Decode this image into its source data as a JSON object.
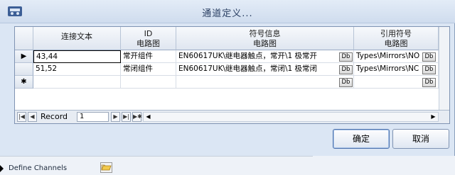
{
  "window": {
    "title": "通道定义..."
  },
  "grid": {
    "columns": [
      {
        "line1": "连接文本",
        "line2": ""
      },
      {
        "line1": "ID",
        "line2": "电路图"
      },
      {
        "line1": "符号信息",
        "line2": "电路图"
      },
      {
        "line1": "引用符号",
        "line2": "电路图"
      }
    ],
    "rows": [
      {
        "marker": "▶",
        "text": "43,44",
        "id": "常开组件",
        "symbol": "EN60617UK\\继电器触点，常开\\1 极常开",
        "ref": "Types\\Mirrors\\NO"
      },
      {
        "marker": "",
        "text": "51,52",
        "id": "常闭组件",
        "symbol": "EN60617UK\\继电器触点，常闭\\1 极常闭",
        "ref": "Types\\Mirrors\\NC"
      },
      {
        "marker": "✱",
        "text": "",
        "id": "",
        "symbol": "",
        "ref": ""
      }
    ],
    "db_label": "Db"
  },
  "navigator": {
    "label": "Record",
    "value": "1"
  },
  "buttons": {
    "ok": "确定",
    "cancel": "取消"
  },
  "background": {
    "channels_label": "Define Channels"
  }
}
